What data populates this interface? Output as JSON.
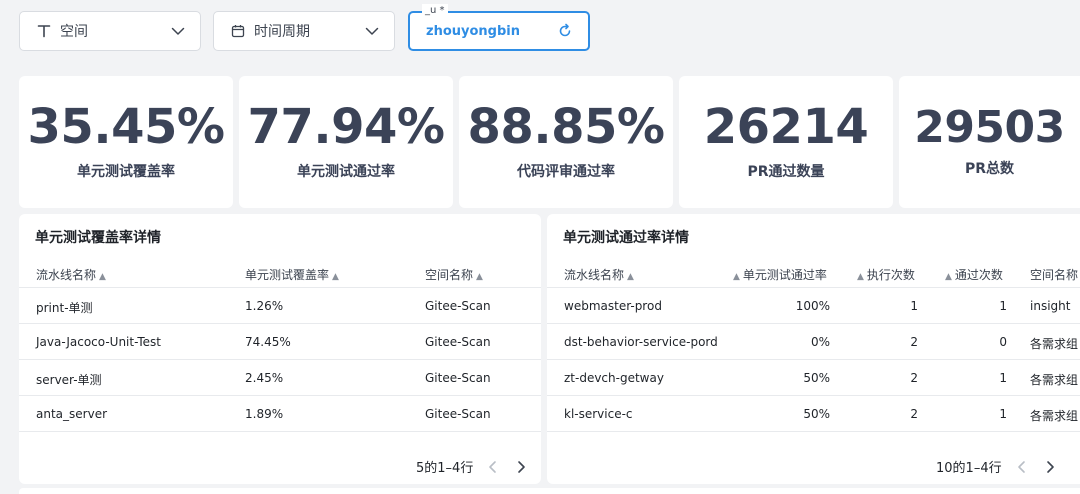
{
  "filters": {
    "space": {
      "label": "空间"
    },
    "period": {
      "label": "时间周期"
    },
    "user": {
      "float_label": "_u *",
      "value": "zhouyongbin"
    }
  },
  "kpis": [
    {
      "value": "35.45%",
      "caption": "单元测试覆盖率"
    },
    {
      "value": "77.94%",
      "caption": "单元测试通过率"
    },
    {
      "value": "88.85%",
      "caption": "代码评审通过率"
    },
    {
      "value": "26214",
      "caption": "PR通过数量"
    },
    {
      "value": "29503",
      "caption": "PR总数"
    }
  ],
  "coverage_table": {
    "title": "单元测试覆盖率详情",
    "columns": [
      "流水线名称",
      "单元测试覆盖率",
      "空间名称"
    ],
    "rows": [
      [
        "print-单测",
        "1.26%",
        "Gitee-Scan"
      ],
      [
        "Java-Jacoco-Unit-Test",
        "74.45%",
        "Gitee-Scan"
      ],
      [
        "server-单测",
        "2.45%",
        "Gitee-Scan"
      ],
      [
        "anta_server",
        "1.89%",
        "Gitee-Scan"
      ]
    ],
    "pagination": "5的1–4行"
  },
  "pass_table": {
    "title": "单元测试通过率详情",
    "columns": [
      "流水线名称",
      "单元测试通过率",
      "执行次数",
      "通过次数",
      "空间名称"
    ],
    "rows": [
      [
        "webmaster-prod",
        "100%",
        "1",
        "1",
        "insight"
      ],
      [
        "dst-behavior-service-pord",
        "0%",
        "2",
        "0",
        "各需求组"
      ],
      [
        "zt-devch-getway",
        "50%",
        "2",
        "1",
        "各需求组"
      ],
      [
        "kl-service-c",
        "50%",
        "2",
        "1",
        "各需求组"
      ]
    ],
    "pagination": "10的1–4行"
  },
  "colors": {
    "accent": "#2f8de4",
    "kpi_text": "#3b4357",
    "background": "#f2f3f5"
  },
  "icons": {
    "space": "text-type-icon",
    "period": "calendar-icon",
    "dropdown": "chevron-down-icon",
    "reset": "refresh-icon",
    "sort": "sort-arrow-up-icon",
    "prev": "chevron-left-icon",
    "next": "chevron-right-icon"
  }
}
